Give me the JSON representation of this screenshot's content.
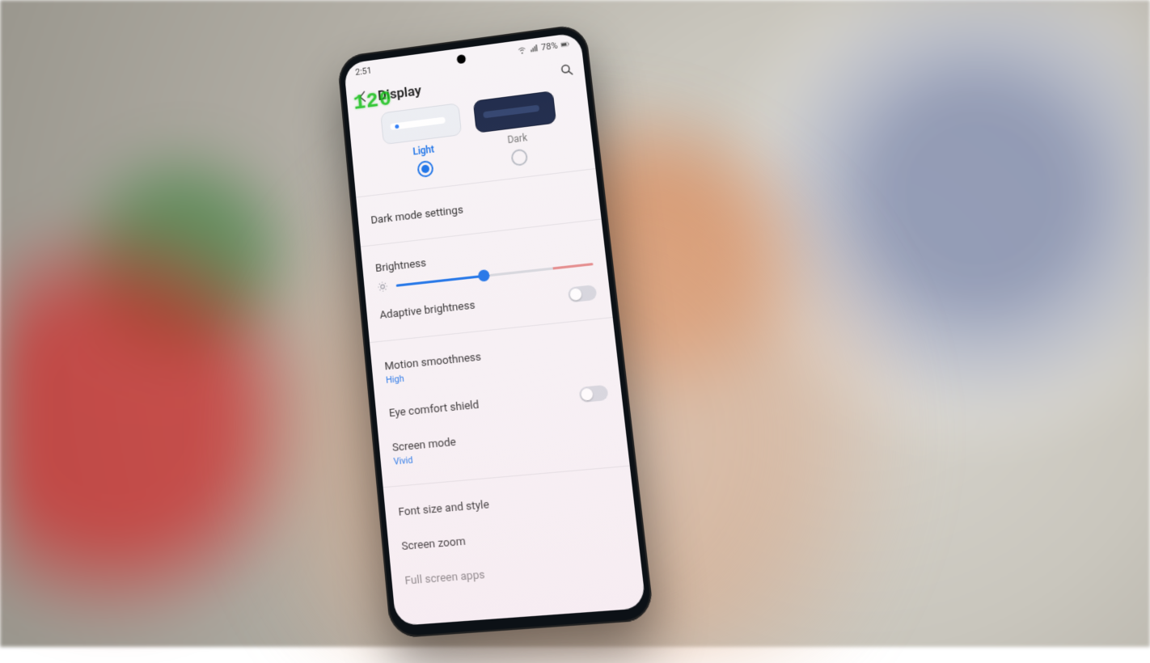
{
  "status": {
    "time": "2:51",
    "battery_text": "78%"
  },
  "overlay": {
    "fps": "120"
  },
  "header": {
    "title": "Display"
  },
  "theme": {
    "light_label": "Light",
    "dark_label": "Dark",
    "selected": "light"
  },
  "items": {
    "dark_mode_settings": "Dark mode settings",
    "brightness": "Brightness",
    "adaptive_brightness": "Adaptive brightness",
    "motion_smoothness": "Motion smoothness",
    "motion_smoothness_value": "High",
    "eye_comfort_shield": "Eye comfort shield",
    "screen_mode": "Screen mode",
    "screen_mode_value": "Vivid",
    "font_size_style": "Font size and style",
    "screen_zoom": "Screen zoom",
    "full_screen_apps": "Full screen apps"
  },
  "brightness_percent": 45,
  "toggles": {
    "adaptive_brightness": false,
    "eye_comfort_shield": false
  }
}
